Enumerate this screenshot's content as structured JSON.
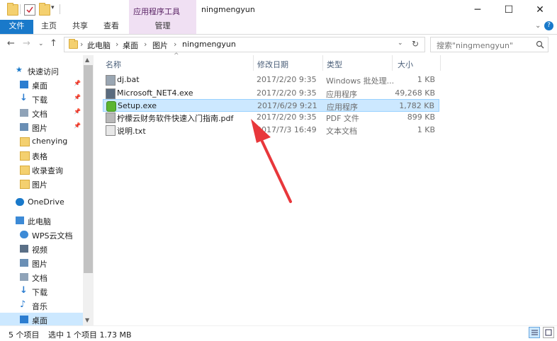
{
  "window": {
    "title": "ningmengyun",
    "contextual_tab_group": "应用程序工具",
    "minimize": "─",
    "maximize": "☐",
    "close": "✕"
  },
  "ribbon": {
    "tabs": [
      "文件",
      "主页",
      "共享",
      "查看",
      "管理"
    ],
    "help": "?"
  },
  "address": {
    "breadcrumb": [
      "此电脑",
      "桌面",
      "图片",
      "ningmengyun"
    ],
    "search_placeholder": "搜索\"ningmengyun\""
  },
  "nav": {
    "items": [
      {
        "label": "快速访问",
        "icon": "star-icon",
        "pinned": false
      },
      {
        "label": "桌面",
        "icon": "desktop-icon",
        "pinned": true
      },
      {
        "label": "下载",
        "icon": "download-icon",
        "pinned": true
      },
      {
        "label": "文档",
        "icon": "document-icon",
        "pinned": true
      },
      {
        "label": "图片",
        "icon": "picture-icon",
        "pinned": true
      },
      {
        "label": "chenying",
        "icon": "folder-icon",
        "pinned": false
      },
      {
        "label": "表格",
        "icon": "folder-icon",
        "pinned": false
      },
      {
        "label": "收录查询",
        "icon": "folder-icon",
        "pinned": false
      },
      {
        "label": "图片",
        "icon": "folder-icon",
        "pinned": false
      },
      {
        "label": "OneDrive",
        "icon": "cloud-icon",
        "pinned": false
      },
      {
        "label": "此电脑",
        "icon": "computer-icon",
        "pinned": false
      },
      {
        "label": "WPS云文档",
        "icon": "wps-cloud-icon",
        "pinned": false
      },
      {
        "label": "视频",
        "icon": "video-icon",
        "pinned": false
      },
      {
        "label": "图片",
        "icon": "picture-icon",
        "pinned": false
      },
      {
        "label": "文档",
        "icon": "document-icon",
        "pinned": false
      },
      {
        "label": "下载",
        "icon": "download-icon",
        "pinned": false
      },
      {
        "label": "音乐",
        "icon": "music-icon",
        "pinned": false
      },
      {
        "label": "桌面",
        "icon": "desktop-icon",
        "pinned": false
      }
    ]
  },
  "columns": {
    "name": "名称",
    "date": "修改日期",
    "type": "类型",
    "size": "大小"
  },
  "files": [
    {
      "name": "dj.bat",
      "date": "2017/2/20 9:35",
      "type": "Windows 批处理...",
      "size": "1 KB",
      "icon": "batch-file-icon"
    },
    {
      "name": "Microsoft_NET4.exe",
      "date": "2017/2/20 9:35",
      "type": "应用程序",
      "size": "49,268 KB",
      "icon": "exe-icon"
    },
    {
      "name": "Setup.exe",
      "date": "2017/6/29 9:21",
      "type": "应用程序",
      "size": "1,782 KB",
      "icon": "setup-icon"
    },
    {
      "name": "柠檬云财务软件快速入门指南.pdf",
      "date": "2017/2/20 9:35",
      "type": "PDF 文件",
      "size": "899 KB",
      "icon": "pdf-icon"
    },
    {
      "name": "说明.txt",
      "date": "2017/7/3 16:49",
      "type": "文本文档",
      "size": "1 KB",
      "icon": "text-file-icon"
    }
  ],
  "status": {
    "item_count": "5 个项目",
    "selection": "选中 1 个项目  1.73 MB"
  },
  "colors": {
    "accent": "#1979ca",
    "selection": "#cce8ff",
    "context_tab": "#f0e0f3",
    "annotation_arrow": "#e8373b"
  }
}
